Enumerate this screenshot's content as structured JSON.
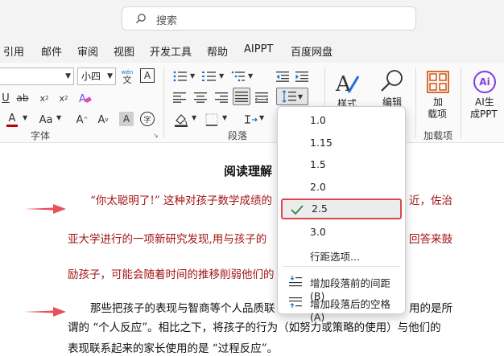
{
  "search": {
    "placeholder": "搜索"
  },
  "menu": {
    "tabs": [
      "引用",
      "邮件",
      "审阅",
      "视图",
      "开发工具",
      "帮助",
      "AIPPT",
      "百度网盘"
    ]
  },
  "ribbon": {
    "font_size": "小四",
    "wen_glyph": "wén",
    "wen_char": "文",
    "groups": {
      "font": "字体",
      "paragraph": "段落",
      "addins": "加载项"
    },
    "styles_label": "样式",
    "edit_label": "编辑",
    "addin_label_1": "加",
    "addin_label_2": "载项",
    "ai_label_1": "AI生",
    "ai_label_2": "成PPT",
    "ai_badge": "Ai",
    "colors": {
      "font_red": "#c00000",
      "accent_blue": "#1e6fd9",
      "ai_purple": "#7b3fe4",
      "addin_orange": "#d04a02"
    }
  },
  "document": {
    "title": "阅读理解",
    "lines": [
      "“你太聪明了!” 这种对孩子数学成绩的",
      "亚大学进行的一项新研究发现,用与孩子的",
      "励孩子，可能会随着时间的推移削弱他们的",
      "那些把孩子的表现与智商等个人品质联",
      "谓的 “个人反应”。相比之下，将孩子的行为（如努力或策略的使用）与他们的",
      "表现联系起来的家长使用的是 “过程反应”。"
    ],
    "line_tails": [
      "近，佐治",
      "回答来鼓",
      "",
      "用的是所"
    ]
  },
  "dropdown": {
    "items": [
      "1.0",
      "1.15",
      "1.5",
      "2.0",
      "2.5",
      "3.0",
      "行距选项..."
    ],
    "selected": "2.5",
    "add_before": "增加段落前的间距(B)",
    "add_after": "增加段落后的空格(A)"
  }
}
